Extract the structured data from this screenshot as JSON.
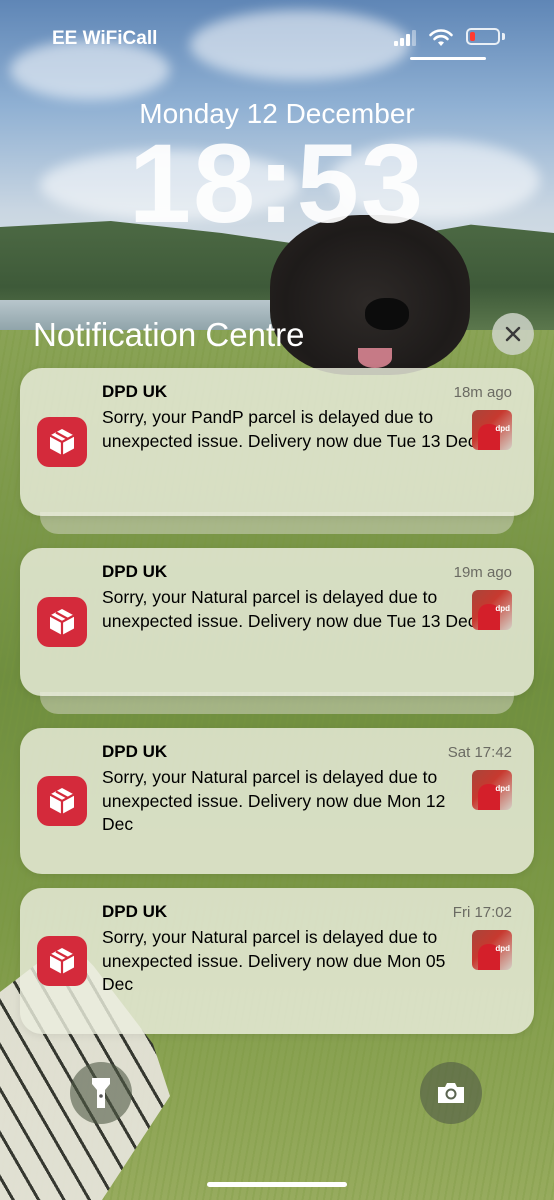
{
  "status_bar": {
    "carrier": "EE WiFiCall",
    "battery_color": "#ff3b30"
  },
  "lock_screen": {
    "date": "Monday 12 December",
    "time": "18:53"
  },
  "notification_centre": {
    "title": "Notification Centre",
    "close_icon": "close-icon"
  },
  "notifications": [
    {
      "app": "DPD UK",
      "time": "18m ago",
      "message": "Sorry, your PandP parcel is delayed due to unexpected issue. Delivery now due Tue 13 Dec"
    },
    {
      "app": "DPD UK",
      "time": "19m ago",
      "message": "Sorry, your Natural parcel is delayed due to unexpected issue. Delivery now due Tue 13 Dec"
    },
    {
      "app": "DPD UK",
      "time": "Sat 17:42",
      "message": "Sorry, your Natural parcel is delayed due to unexpected issue. Delivery now due Mon 12 Dec"
    },
    {
      "app": "DPD UK",
      "time": "Fri 17:02",
      "message": "Sorry, your Natural parcel is delayed due to unexpected issue. Delivery now due Mon 05 Dec"
    }
  ],
  "thumbnail_logo": "dpd",
  "app_icon": {
    "name": "dpd-cube-icon",
    "color": "#d42a3b"
  },
  "bottom_controls": {
    "left_icon": "flashlight-icon",
    "right_icon": "camera-icon"
  }
}
